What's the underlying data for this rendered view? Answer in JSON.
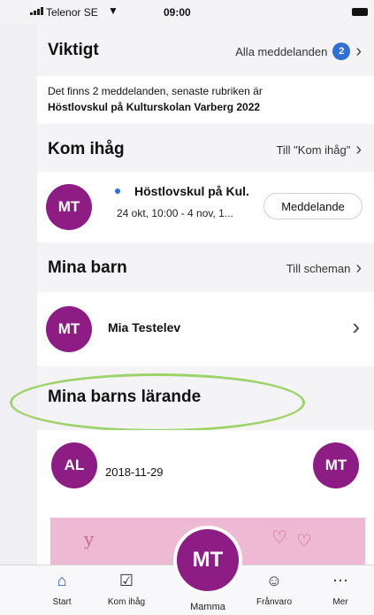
{
  "status_bar": {
    "carrier": "Telenor SE",
    "time": "09:00"
  },
  "viktigt": {
    "title": "Viktigt",
    "link": "Alla meddelanden",
    "badge": "2",
    "message_intro": "Det finns 2 meddelanden, senaste rubriken är",
    "message_headline": "Höstlovskul på Kulturskolan Varberg 2022"
  },
  "kom_ihag": {
    "title": "Kom ihåg",
    "link": "Till \"Kom ihåg\"",
    "item": {
      "avatar": "MT",
      "title": "Höstlovskul på Kul.",
      "date": "24 okt, 10:00 - 4 nov, 1...",
      "button": "Meddelande"
    }
  },
  "mina_barn": {
    "title": "Mina barn",
    "link": "Till scheman",
    "child": {
      "avatar": "MT",
      "name": "Mia Testelev"
    }
  },
  "larande": {
    "title": "Mina barns lärande",
    "post": {
      "avatar": "AL",
      "date": "2018-11-29",
      "avatar_right": "MT"
    }
  },
  "tabbar": {
    "start": "Start",
    "kom_ihag": "Kom ihåg",
    "center_avatar": "MT",
    "center_label": "Mamma",
    "franvaro": "Frånvaro",
    "mer": "Mer"
  },
  "colors": {
    "accent": "#8e1c85",
    "badge": "#2f6fd6",
    "highlight": "#9ed36a"
  }
}
